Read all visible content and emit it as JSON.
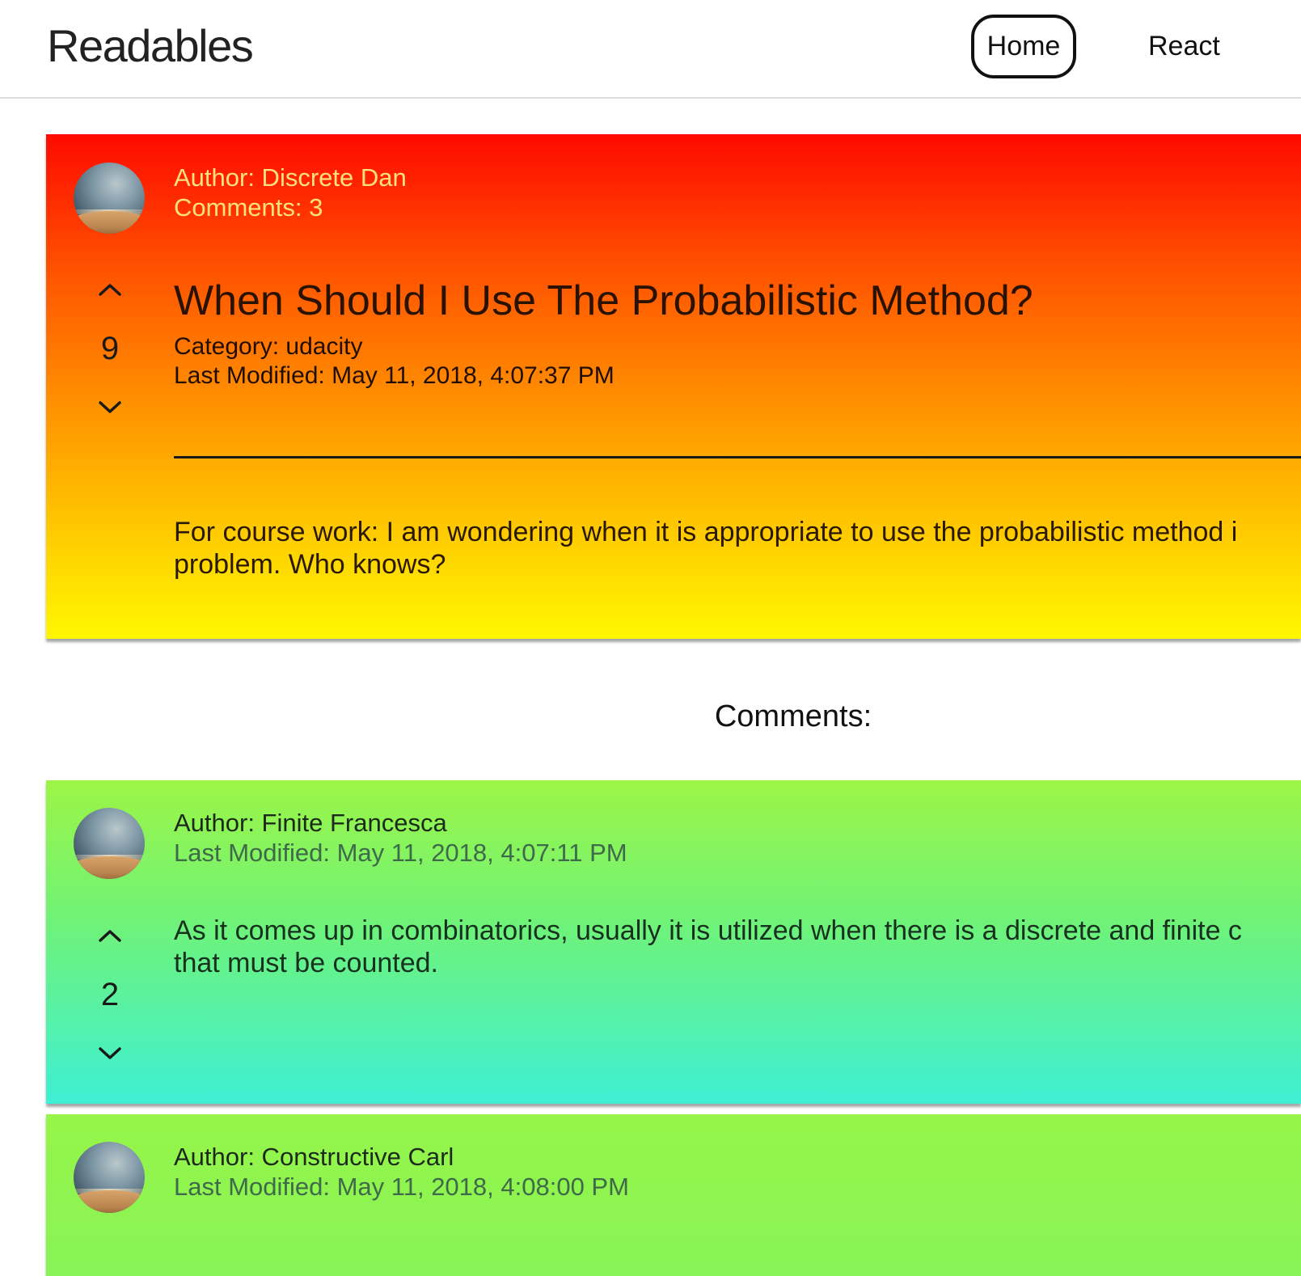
{
  "header": {
    "brand": "Readables",
    "nav": {
      "home_label": "Home",
      "react_label": "React"
    }
  },
  "post": {
    "author": "Author: Discrete Dan",
    "comments_count": "Comments: 3",
    "vote_score": "9",
    "title": "When Should I Use The Probabilistic Method?",
    "category": "Category: udacity",
    "last_modified": "Last Modified: May 11, 2018, 4:07:37 PM",
    "body_line_1": "For course work: I am wondering when it is appropriate to use the probabilistic method i",
    "body_line_2": "problem. Who knows?"
  },
  "comments_heading": "Comments:",
  "comments": [
    {
      "author": "Author: Finite Francesca",
      "last_modified": "Last Modified: May 11, 2018, 4:07:11 PM",
      "vote_score": "2",
      "body_line_1": "As it comes up in combinatorics, usually it is utilized when there is a discrete and finite c",
      "body_line_2": "that must be counted."
    },
    {
      "author": "Author: Constructive Carl",
      "last_modified": "Last Modified: May 11, 2018, 4:08:00 PM"
    }
  ],
  "icons": {
    "upvote": "chevron-up-icon",
    "downvote": "chevron-down-icon",
    "avatar": "avatar-image"
  },
  "colors": {
    "post_gradient_top": "#ff0a00",
    "post_gradient_bottom": "#fff700",
    "comment_gradient_top": "#9cf545",
    "comment_gradient_bottom": "#3ef0d4",
    "post_meta_text": "#ffe27a"
  }
}
